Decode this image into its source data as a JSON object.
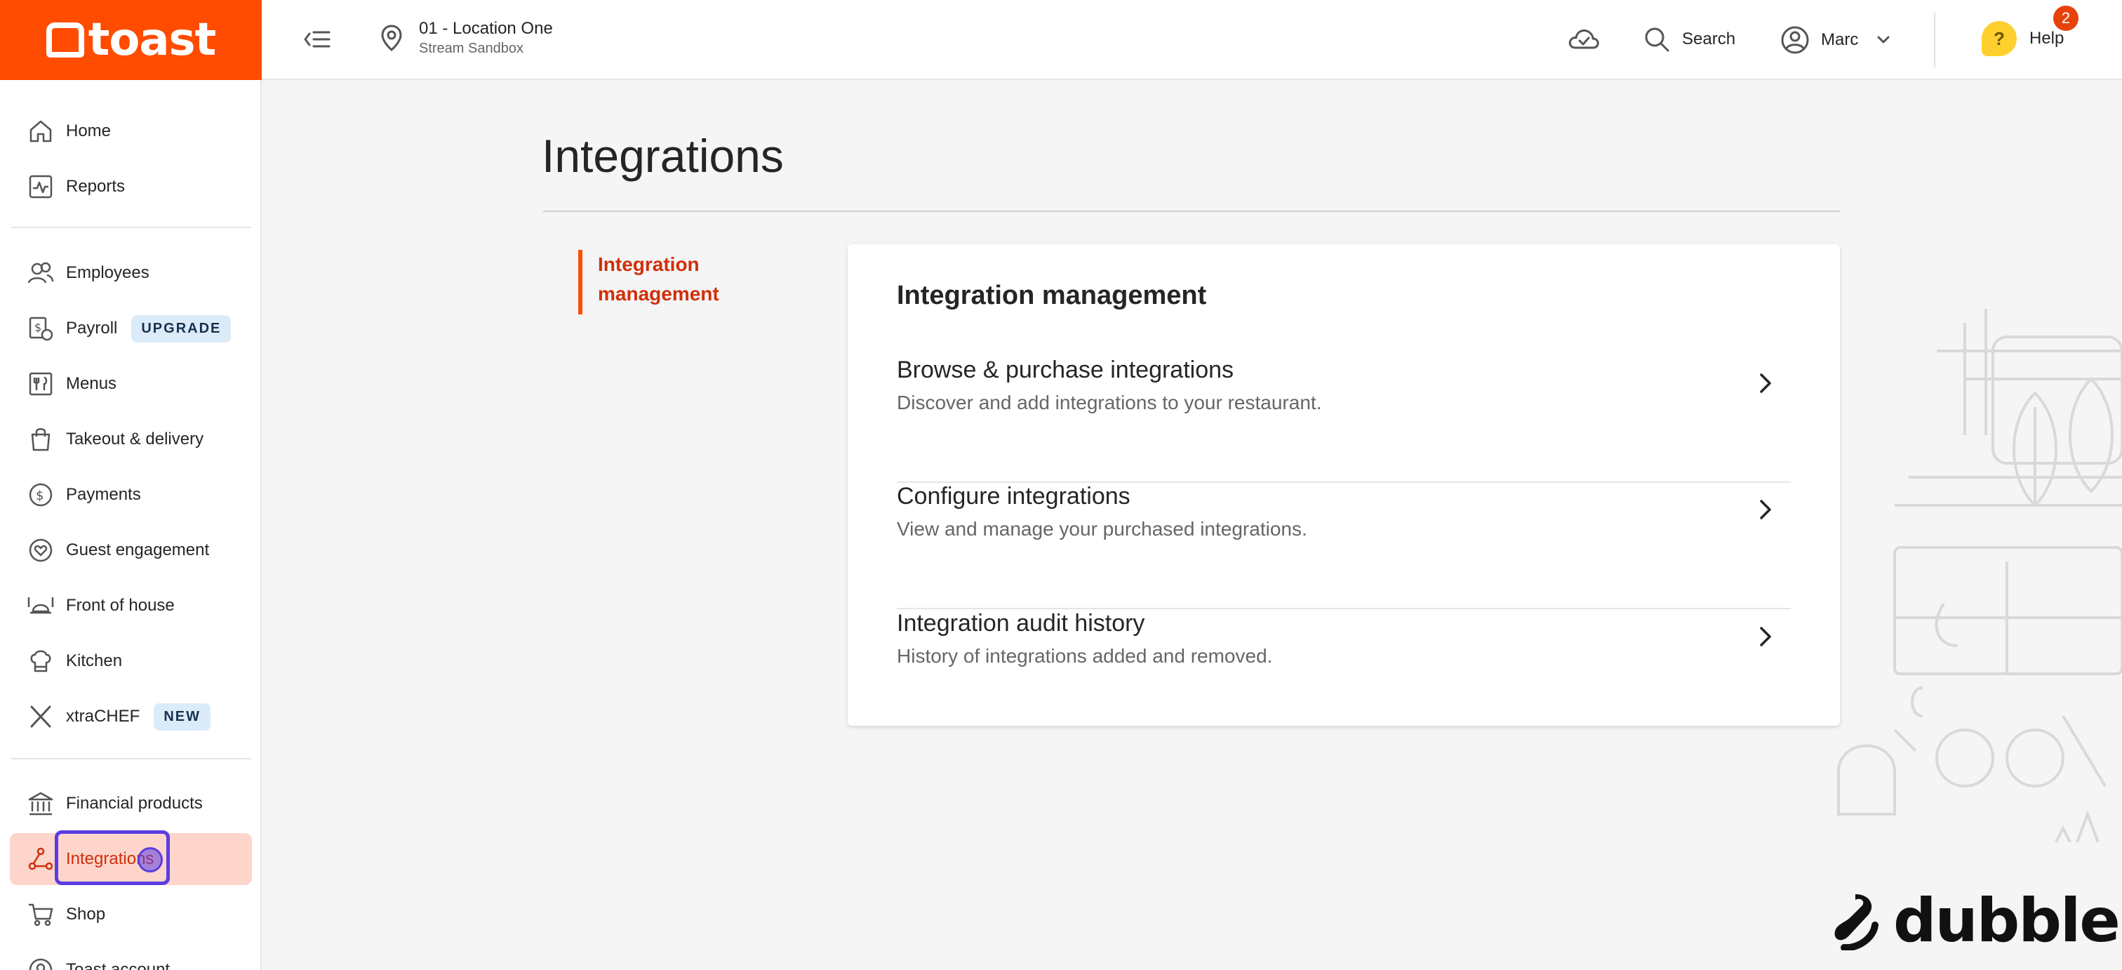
{
  "brand": {
    "logo_text": "toast",
    "accent": "#ff4c00"
  },
  "header": {
    "location_name": "01 - Location One",
    "location_sub": "Stream Sandbox",
    "search_label": "Search",
    "user_label": "Marc",
    "help_label": "Help",
    "help_badge": "2",
    "icons": [
      "collapse-menu-icon",
      "location-pin-icon",
      "cloud-check-icon",
      "search-icon",
      "user-icon",
      "chevron-down-icon",
      "help-icon"
    ]
  },
  "sidebar": {
    "items": [
      {
        "label": "Home",
        "icon": "home-icon"
      },
      {
        "label": "Reports",
        "icon": "reports-icon"
      },
      {
        "label": "Employees",
        "icon": "employees-icon"
      },
      {
        "label": "Payroll",
        "icon": "payroll-icon",
        "tag": "UPGRADE"
      },
      {
        "label": "Menus",
        "icon": "menus-icon"
      },
      {
        "label": "Takeout & delivery",
        "icon": "takeout-icon"
      },
      {
        "label": "Payments",
        "icon": "payments-icon"
      },
      {
        "label": "Guest engagement",
        "icon": "guest-engagement-icon"
      },
      {
        "label": "Front of house",
        "icon": "front-of-house-icon"
      },
      {
        "label": "Kitchen",
        "icon": "kitchen-icon"
      },
      {
        "label": "xtraCHEF",
        "icon": "xtrachef-icon",
        "tag": "NEW"
      },
      {
        "label": "Financial products",
        "icon": "bank-icon"
      },
      {
        "label": "Integrations",
        "icon": "integrations-icon",
        "active": true
      },
      {
        "label": "Shop",
        "icon": "cart-icon"
      },
      {
        "label": "Toast account",
        "icon": "account-icon"
      }
    ]
  },
  "main": {
    "title": "Integrations",
    "subnav_label": "Integration management",
    "card": {
      "heading": "Integration management",
      "rows": [
        {
          "title": "Browse & purchase integrations",
          "description": "Discover and add integrations to your restaurant."
        },
        {
          "title": "Configure integrations",
          "description": "View and manage your purchased integrations."
        },
        {
          "title": "Integration audit history",
          "description": "History of integrations added and removed."
        }
      ]
    }
  },
  "watermark": {
    "text": "dubble"
  }
}
